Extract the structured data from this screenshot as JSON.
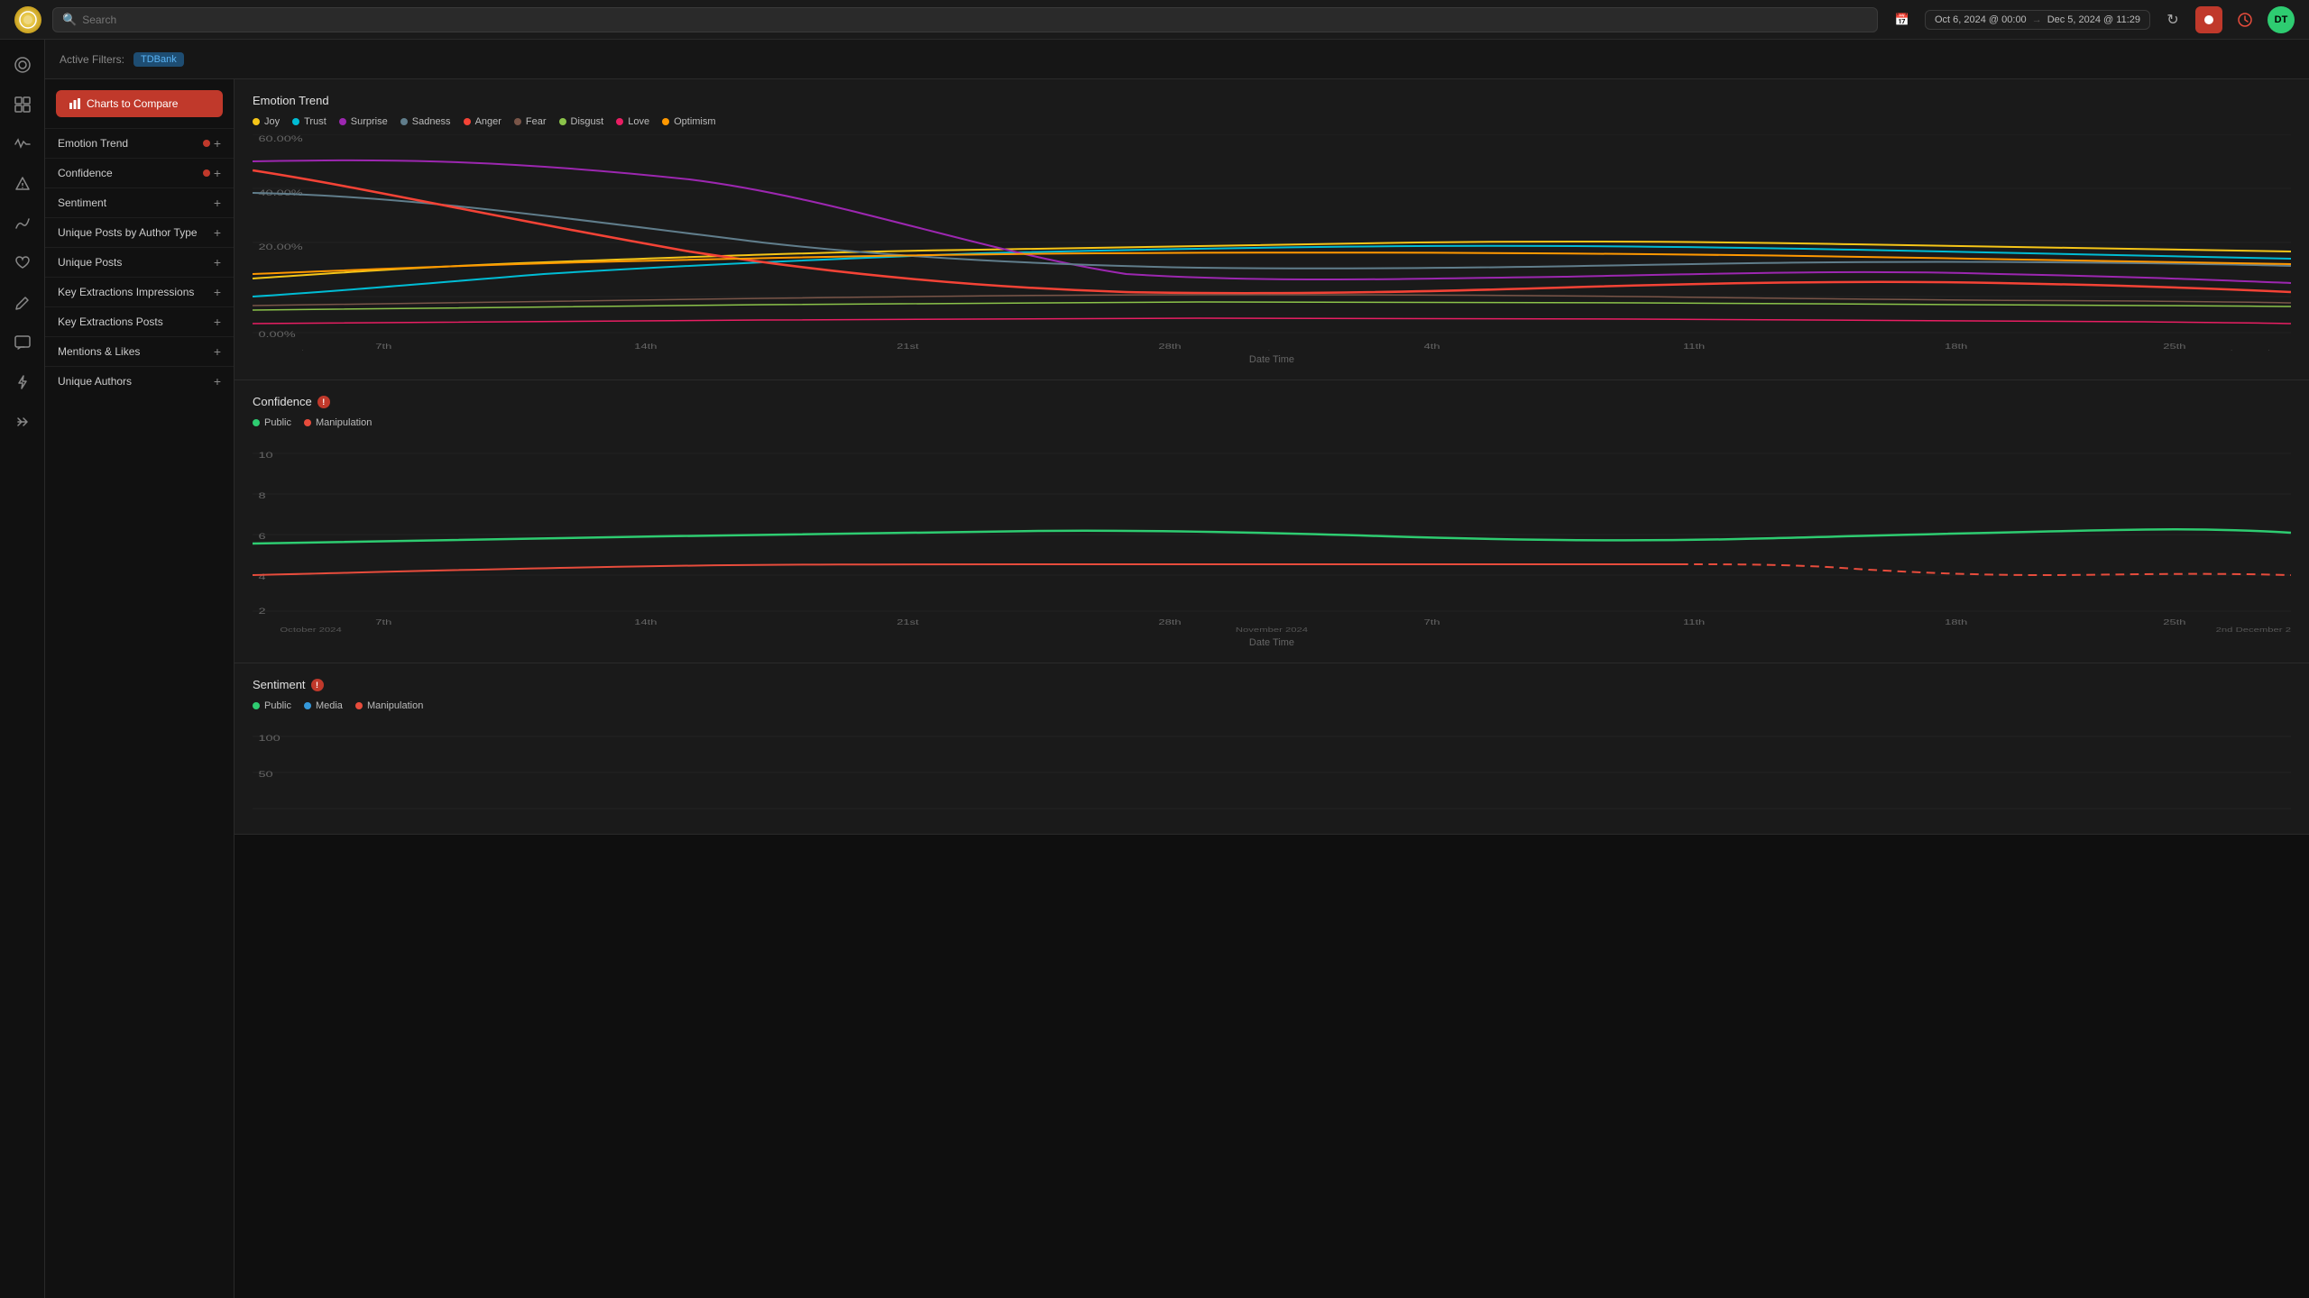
{
  "topnav": {
    "logo": "◎",
    "search_placeholder": "Search",
    "date_start": "Oct 6, 2024 @ 00:00",
    "date_end": "Dec 5, 2024 @ 11:29",
    "avatar_initials": "DT",
    "refresh_icon": "↻"
  },
  "filter_bar": {
    "label": "Active Filters:",
    "tag": "TDBank"
  },
  "charts_panel": {
    "button_label": "Charts to Compare",
    "items": [
      {
        "id": "emotion-trend",
        "label": "Emotion Trend",
        "has_dot": true,
        "dot_color": "red"
      },
      {
        "id": "confidence",
        "label": "Confidence",
        "has_dot": true,
        "dot_color": "red"
      },
      {
        "id": "sentiment",
        "label": "Sentiment",
        "has_dot": false
      },
      {
        "id": "unique-posts-author",
        "label": "Unique Posts by Author Type",
        "has_dot": false
      },
      {
        "id": "unique-posts",
        "label": "Unique Posts",
        "has_dot": false
      },
      {
        "id": "key-extractions-impressions",
        "label": "Key Extractions Impressions",
        "has_dot": false
      },
      {
        "id": "key-extractions-posts",
        "label": "Key Extractions Posts",
        "has_dot": false
      },
      {
        "id": "mentions-likes",
        "label": "Mentions & Likes",
        "has_dot": false
      },
      {
        "id": "unique-authors",
        "label": "Unique Authors",
        "has_dot": false
      }
    ]
  },
  "sidebar": {
    "icons": [
      {
        "id": "home",
        "symbol": "⌂",
        "active": false
      },
      {
        "id": "dashboard",
        "symbol": "▦",
        "active": false
      },
      {
        "id": "pulse",
        "symbol": "⬤",
        "active": false
      },
      {
        "id": "alert",
        "symbol": "△",
        "active": false
      },
      {
        "id": "analytics",
        "symbol": "〜",
        "active": false
      },
      {
        "id": "heart",
        "symbol": "♡",
        "active": false
      },
      {
        "id": "edit",
        "symbol": "✎",
        "active": false
      },
      {
        "id": "messages",
        "symbol": "▣",
        "active": false
      },
      {
        "id": "lightning",
        "symbol": "⚡",
        "active": false
      },
      {
        "id": "share",
        "symbol": "⇌",
        "active": false
      }
    ]
  },
  "charts": {
    "emotion_trend": {
      "title": "Emotion Trend",
      "axis_label": "Date Time",
      "legend": [
        {
          "label": "Joy",
          "color": "#f5c518"
        },
        {
          "label": "Trust",
          "color": "#00bcd4"
        },
        {
          "label": "Surprise",
          "color": "#9c27b0"
        },
        {
          "label": "Sadness",
          "color": "#607d8b"
        },
        {
          "label": "Anger",
          "color": "#f44336"
        },
        {
          "label": "Fear",
          "color": "#795548"
        },
        {
          "label": "Disgust",
          "color": "#8bc34a"
        },
        {
          "label": "Love",
          "color": "#e91e63"
        },
        {
          "label": "Optimism",
          "color": "#ff9800"
        }
      ]
    },
    "confidence": {
      "title": "Confidence",
      "axis_label": "Date Time",
      "legend": [
        {
          "label": "Public",
          "color": "#2ecc71"
        },
        {
          "label": "Manipulation",
          "color": "#e74c3c"
        }
      ]
    },
    "sentiment": {
      "title": "Sentiment",
      "axis_label": "",
      "legend": [
        {
          "label": "Public",
          "color": "#2ecc71"
        },
        {
          "label": "Media",
          "color": "#3498db"
        },
        {
          "label": "Manipulation",
          "color": "#e74c3c"
        }
      ]
    }
  }
}
